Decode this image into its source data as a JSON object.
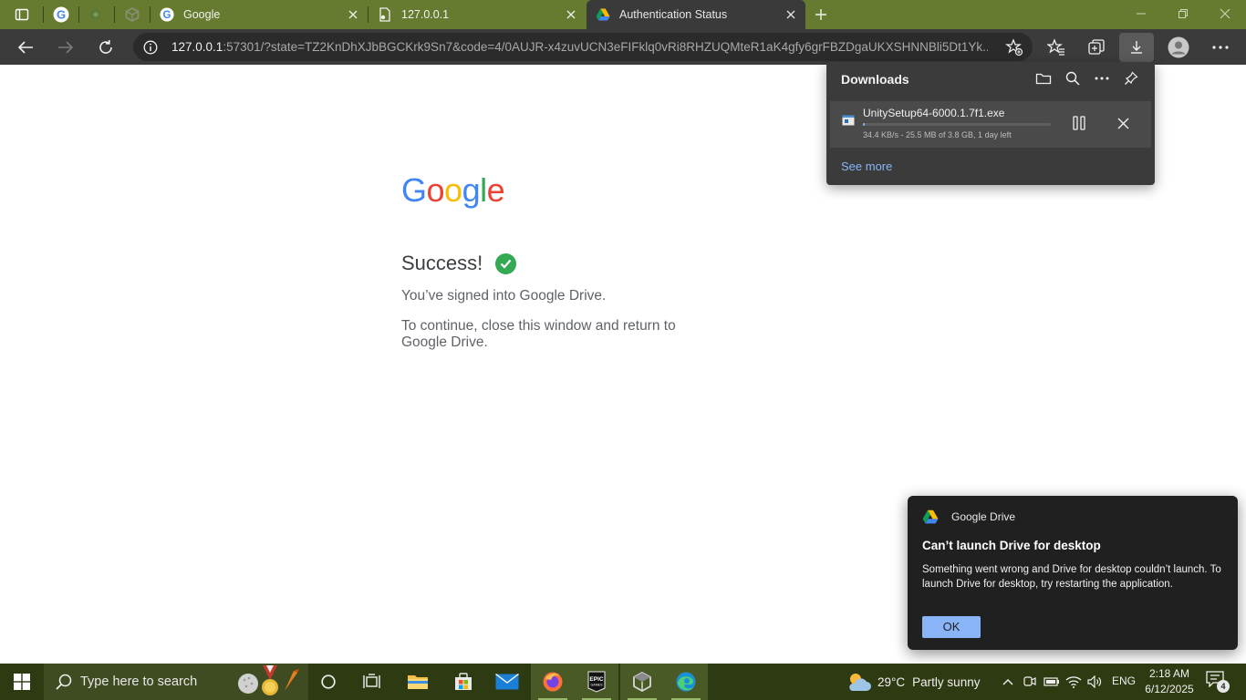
{
  "browser": {
    "tabs": [
      {
        "title": "Google"
      },
      {
        "title": "127.0.0.1"
      },
      {
        "title": "Authentication Status"
      }
    ],
    "url_host": "127.0.0.1",
    "url_rest": ":57301/?state=TZ2KnDhXJbBGCKrk9Sn7&code=4/0AUJR-x4zuvUCN3eFIFklq0vRi8RHZUQMteR1aK4gfy6grFBZDgaUKXSHNNBli5Dt1Yk..."
  },
  "page": {
    "logo_letters": [
      "G",
      "o",
      "o",
      "g",
      "l",
      "e"
    ],
    "logo_colors": [
      "#4285f4",
      "#ea4335",
      "#fbbc05",
      "#4285f4",
      "#34a853",
      "#ea4335"
    ],
    "success_title": "Success!",
    "signed_in_text": "You’ve signed into Google Drive.",
    "continue_text": "To continue, close this window and return to Google Drive."
  },
  "downloads": {
    "title": "Downloads",
    "file_name": "UnitySetup64-6000.1.7f1.exe",
    "status": "34.4 KB/s - 25.5 MB of 3.8 GB, 1 day left",
    "progress_fraction": 0.0066,
    "see_more": "See more"
  },
  "toast": {
    "app_name": "Google Drive",
    "title": "Can’t launch Drive for desktop",
    "body": "Something went wrong and Drive for desktop couldn’t launch. To launch Drive for desktop, try restarting the application.",
    "ok_label": "OK"
  },
  "taskbar": {
    "search_placeholder": "Type here to search",
    "weather_temp": "29°C",
    "weather_desc": "Partly sunny",
    "language": "ENG",
    "time": "2:18 AM",
    "date": "6/12/2025",
    "notification_count": "4"
  },
  "colors": {
    "tabstrip": "#667b2f",
    "toolbar": "#3b3b3b",
    "taskbar": "#2e3a12",
    "accent_link": "#8ab4f8",
    "success_green": "#34a853"
  }
}
